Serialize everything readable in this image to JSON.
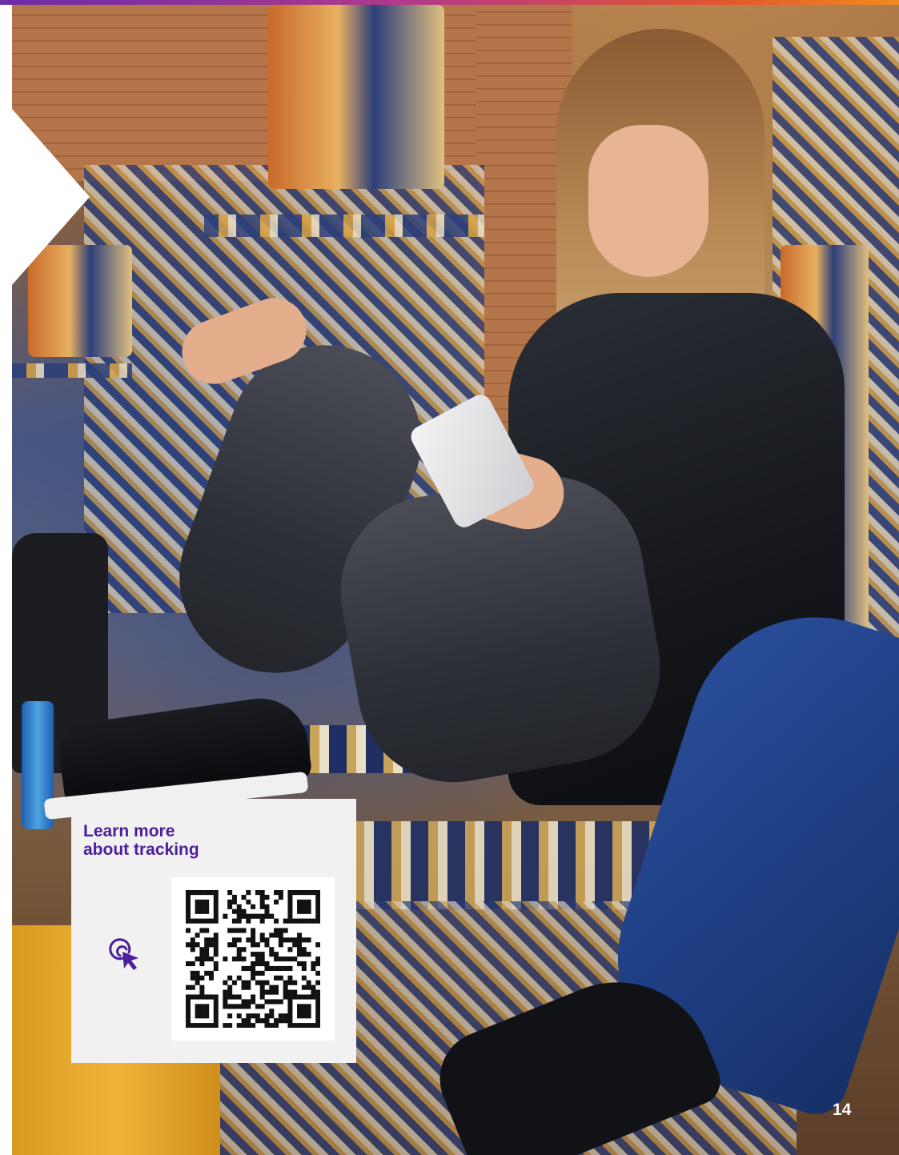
{
  "card": {
    "title_line1": "Learn more",
    "title_line2": "about tracking",
    "icon": "cursor-click-icon",
    "qr": "qr-code"
  },
  "page_number": "14",
  "colors": {
    "accent_purple": "#4b1f99",
    "card_background": "#f1f1f2",
    "stripe_gradient": [
      "#6a2ca8",
      "#b23a8a",
      "#e2552f",
      "#f08a1d"
    ]
  }
}
